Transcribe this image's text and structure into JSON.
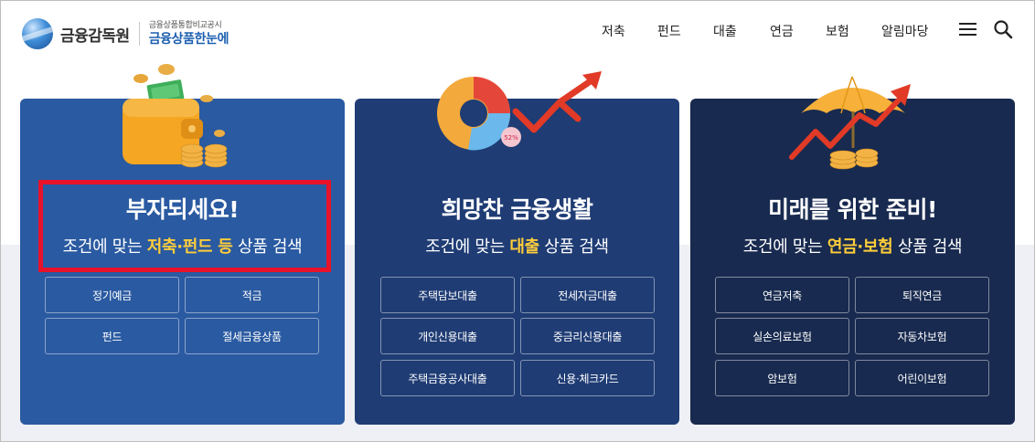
{
  "header": {
    "logo_text": "금융감독원",
    "logo_sub_small": "금융상품통합비교공시",
    "logo_sub_big": "금융상품한눈에",
    "nav": [
      "저축",
      "펀드",
      "대출",
      "연금",
      "보험",
      "알림마당"
    ]
  },
  "cards": [
    {
      "title": "부자되세요!",
      "sub_prefix": "조건에 맞는 ",
      "sub_highlight": "저축·펀드 등",
      "sub_suffix": " 상품 검색",
      "buttons": [
        "정기예금",
        "적금",
        "펀드",
        "절세금융상품"
      ]
    },
    {
      "title": "희망찬 금융생활",
      "sub_prefix": "조건에 맞는 ",
      "sub_highlight": "대출",
      "sub_suffix": " 상품 검색",
      "buttons": [
        "주택담보대출",
        "전세자금대출",
        "개인신용대출",
        "중금리신용대출",
        "주택금융공사대출",
        "신용·체크카드"
      ]
    },
    {
      "title": "미래를 위한 준비!",
      "sub_prefix": "조건에 맞는 ",
      "sub_highlight": "연금·보험",
      "sub_suffix": " 상품 검색",
      "buttons": [
        "연금저축",
        "퇴직연금",
        "실손의료보험",
        "자동차보험",
        "암보험",
        "어린이보험"
      ]
    }
  ],
  "chart_badge": "52%",
  "colors": {
    "card1": "#2a5aa1",
    "card2": "#1f3c74",
    "card3": "#182a4f",
    "highlight_text": "#ffcd3b",
    "annotation_box": "#e8132a"
  }
}
